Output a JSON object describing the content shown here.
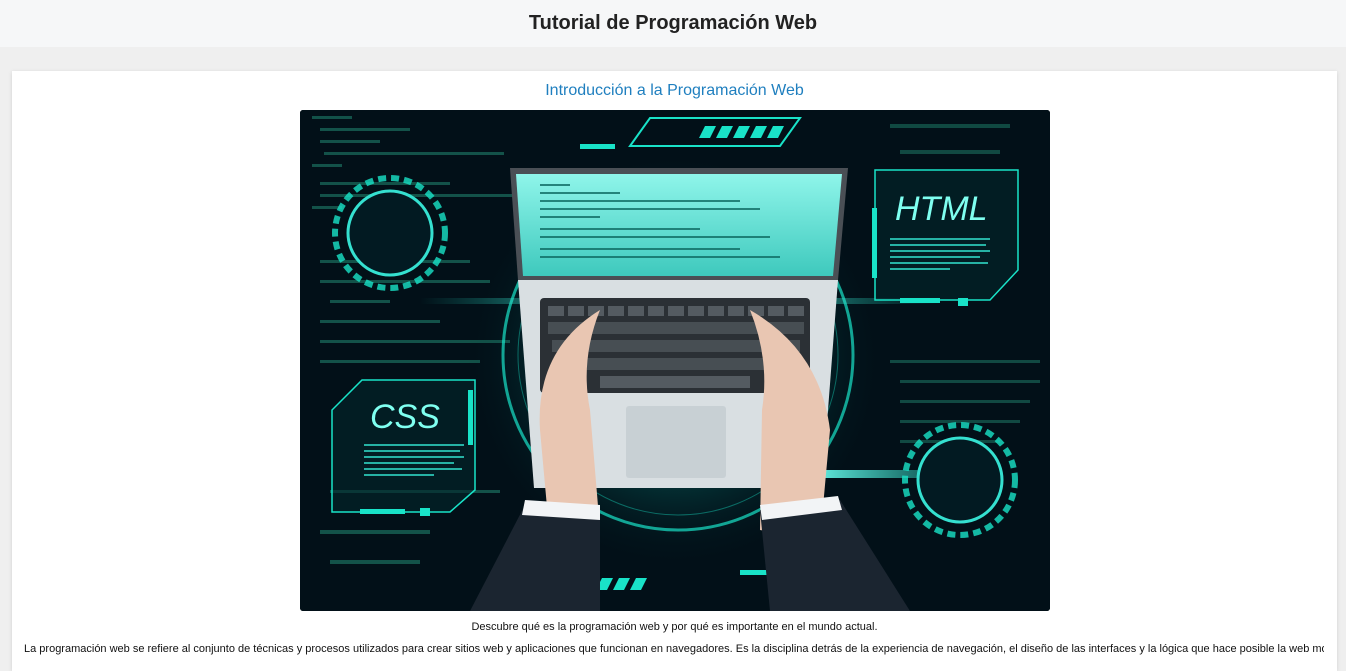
{
  "header": {
    "title": "Tutorial de Programación Web"
  },
  "article": {
    "section_title": "Introducción a la Programación Web",
    "image_caption": "Descubre qué es la programación web y por qué es importante en el mundo actual.",
    "hero_labels": {
      "html": "HTML",
      "css": "CSS"
    },
    "body_text": "La programación web se refiere al conjunto de técnicas y procesos utilizados para crear sitios web y aplicaciones que funcionan en navegadores. Es la disciplina detrás de la experiencia de navegación, el diseño de las interfaces y la lógica que hace posible la web moderna."
  },
  "colors": {
    "accent": "#1f7fbf",
    "neon": "#19e3c8",
    "hero_bg": "#021018"
  }
}
